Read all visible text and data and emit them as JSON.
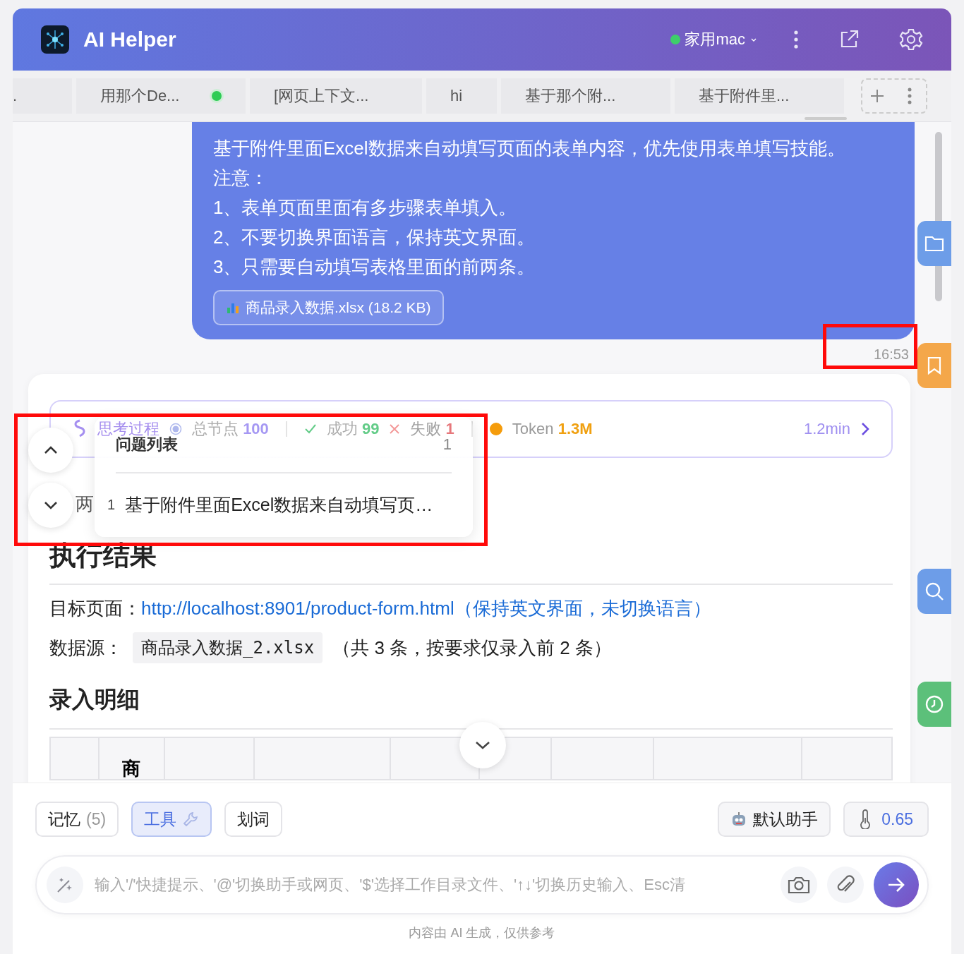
{
  "header": {
    "title": "AI Helper",
    "device": {
      "label": "家用mac",
      "online": true
    }
  },
  "tabs": [
    {
      "label": ".",
      "running": false
    },
    {
      "label": "用那个De...",
      "running": true
    },
    {
      "label": "[网页上下文...",
      "running": false
    },
    {
      "label": "hi",
      "running": false
    },
    {
      "label": "基于那个附...",
      "running": false
    },
    {
      "label": "基于附件里...",
      "running": false
    }
  ],
  "message": {
    "lines": [
      "基于附件里面Excel数据来自动填写页面的表单内容，优先使用表单填写技能。",
      "注意：",
      "1、表单页面里面有多步骤表单填入。",
      "2、不要切换界面语言，保持英文界面。",
      "3、只需要自动填写表格里面的前两条。"
    ],
    "attachment": "商品录入数据.xlsx (18.2 KB)",
    "time": "16:53"
  },
  "stats": {
    "thinking": "思考过程",
    "total_label": "总节点",
    "total": "100",
    "success_label": "成功",
    "success": "99",
    "fail_label": "失败",
    "fail": "1",
    "token_label": "Token",
    "token": "1.3M",
    "duration": "1.2min"
  },
  "popup": {
    "title": "问题列表",
    "count": "1",
    "items": [
      {
        "index": "1",
        "text": "基于附件里面Excel数据来自动填写页…"
      }
    ]
  },
  "result": {
    "status": "两",
    "heading": "执行结果",
    "target_label": "目标页面：",
    "target_link": "http://localhost:8901/product-form.html（保持英文界面，未切换语言）",
    "source_label": "数据源：",
    "source_file": "商品录入数据_2.xlsx",
    "source_note": "（共 3 条，按要求仅录入前 2 条）",
    "details_heading": "录入明细",
    "table_header_2": "商"
  },
  "toolbar": {
    "chips": [
      {
        "kind": "memory",
        "label": "记忆",
        "count": "(5)",
        "selected": false
      },
      {
        "kind": "tools",
        "label": "工具",
        "selected": true
      },
      {
        "kind": "plain",
        "label": "划词",
        "selected": false
      }
    ],
    "assistant": "默认助手",
    "temperature": "0.65"
  },
  "input": {
    "placeholder": "输入'/'快捷提示、'@'切换助手或网页、'$'选择工作目录文件、'↑↓'切换历史输入、Esc清"
  },
  "footer": "内容由 AI 生成，仅供参考"
}
